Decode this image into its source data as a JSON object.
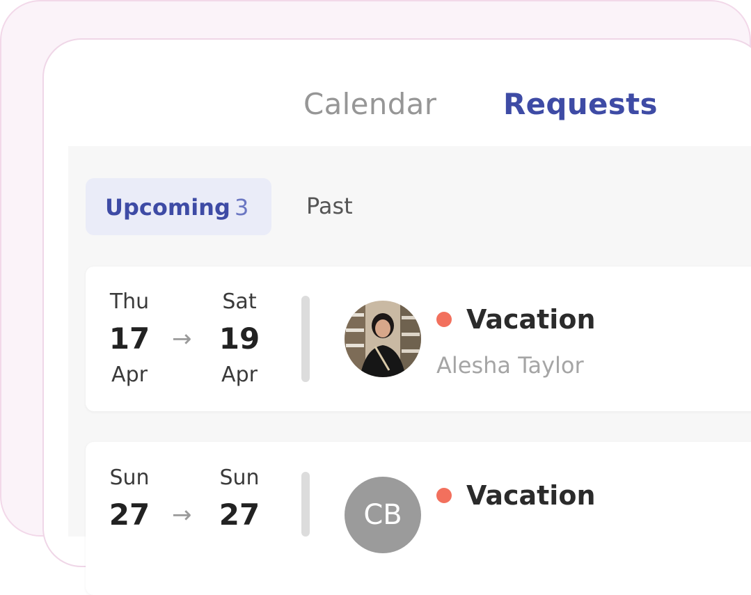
{
  "tabs": {
    "calendar": "Calendar",
    "requests": "Requests",
    "active": "requests"
  },
  "filters": {
    "upcoming_label": "Upcoming",
    "upcoming_count": "3",
    "past_label": "Past",
    "active": "upcoming"
  },
  "requests": [
    {
      "start": {
        "dow": "Thu",
        "day": "17",
        "month": "Apr"
      },
      "end": {
        "dow": "Sat",
        "day": "19",
        "month": "Apr"
      },
      "arrow": "→",
      "type": "Vacation",
      "person": "Alesha Taylor",
      "avatar": "photo",
      "status_color": "#f2705d"
    },
    {
      "start": {
        "dow": "Sun",
        "day": "27"
      },
      "end": {
        "dow": "Sun",
        "day": "27"
      },
      "arrow": "→",
      "type": "Vacation",
      "avatar_initials": "CB",
      "status_color": "#f2705d"
    }
  ],
  "colors": {
    "accent": "#3e4ba5",
    "status_dot": "#f2705d",
    "frame": "#fbf3f9"
  }
}
